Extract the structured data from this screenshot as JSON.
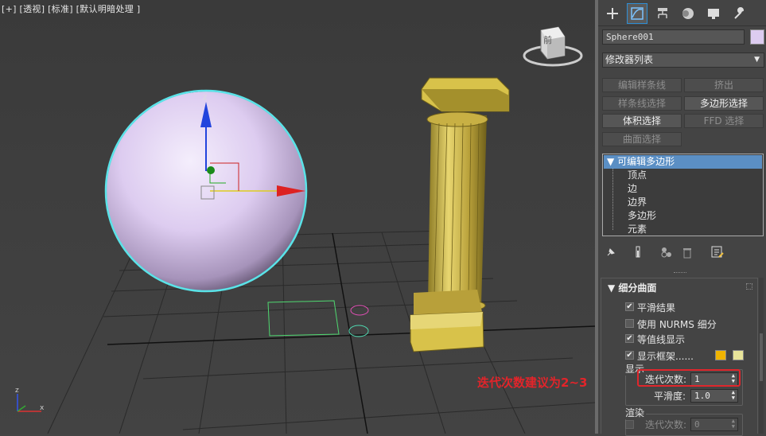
{
  "viewport": {
    "label": "[+] [透视] [标准] [默认明暗处理 ]",
    "viewcube_text": "前",
    "annotation": "迭代次数建议为2~3",
    "axis_x": "x",
    "axis_z": "z"
  },
  "colors": {
    "selection_outline": "#5ae3e8",
    "sphere": "#ddccf0",
    "column": "#d8c24a",
    "annotation": "#e2242a",
    "highlight_box": "#e0262c",
    "stack_selected": "#5b8fc4"
  },
  "tabs": [
    "create-tab",
    "modify-tab",
    "hierarchy-tab",
    "motion-tab",
    "display-tab",
    "utilities-tab"
  ],
  "object": {
    "name": "Sphere001",
    "color": "#ddccf0"
  },
  "modifier_list": "修改器列表",
  "modifier_buttons": [
    {
      "label": "编辑样条线",
      "enabled": false
    },
    {
      "label": "挤出",
      "enabled": false
    },
    {
      "label": "样条线选择",
      "enabled": false
    },
    {
      "label": "多边形选择",
      "enabled": true
    },
    {
      "label": "体积选择",
      "enabled": true
    },
    {
      "label": "FFD 选择",
      "enabled": false
    },
    {
      "label": "曲面选择",
      "enabled": false
    }
  ],
  "stack": {
    "header": "可编辑多边形",
    "items": [
      "顶点",
      "边",
      "边界",
      "多边形",
      "元素"
    ]
  },
  "rollout": {
    "title": "细分曲面",
    "smooth_result": {
      "label": "平滑结果",
      "checked": true
    },
    "use_nurms": {
      "label": "使用 NURMS 细分",
      "checked": false
    },
    "isoline": {
      "label": "等值线显示",
      "checked": true
    },
    "show_cage": {
      "label": "显示框架......",
      "checked": true,
      "color1": "#f0b400",
      "color2": "#e8e49a"
    },
    "display_group": "显示",
    "iterations_label": "迭代次数:",
    "iterations_value": "1",
    "smoothness_label": "平滑度:",
    "smoothness_value": "1.0",
    "render_group": "渲染",
    "render_iterations_label": "迭代次数:",
    "render_iterations_value": "0"
  }
}
